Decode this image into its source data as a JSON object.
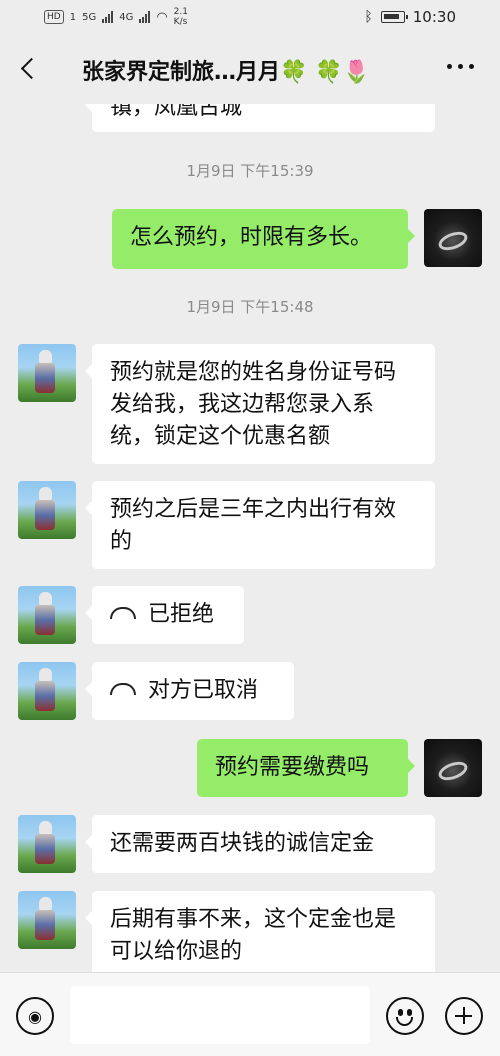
{
  "status_bar": {
    "hd": "HD",
    "sim": "1",
    "net1": "5G",
    "net2": "4G",
    "speed": "2.1 K/s",
    "time": "10:30"
  },
  "header": {
    "title": "张家界定制旅…月月🍀 🍀🌷",
    "back_icon": "chevron-left-icon",
    "more_icon": "more-dots-icon"
  },
  "chat": {
    "partial_message": "镇，凤凰古城",
    "timestamps": [
      "1月9日 下午15:39",
      "1月9日 下午15:48"
    ],
    "messages": [
      {
        "side": "self",
        "text": "怎么预约，时限有多长。"
      },
      {
        "side": "other",
        "text": "预约就是您的姓名身份证号码发给我，我这边帮您录入系统，锁定这个优惠名额"
      },
      {
        "side": "other",
        "text": "预约之后是三年之内出行有效的"
      },
      {
        "side": "other",
        "text": "已拒绝",
        "call": true
      },
      {
        "side": "other",
        "text": "对方已取消",
        "call": true
      },
      {
        "side": "self",
        "text": "预约需要缴费吗"
      },
      {
        "side": "other",
        "text": "还需要两百块钱的诚信定金"
      },
      {
        "side": "other",
        "text": "后期有事不来，这个定金也是可以给你退的"
      }
    ]
  },
  "input_bar": {
    "voice_icon": "voice-icon",
    "emoji_icon": "emoji-icon",
    "plus_icon": "plus-icon",
    "placeholder": ""
  },
  "colors": {
    "background": "#ededed",
    "self_bubble": "#95ec69",
    "other_bubble": "#ffffff",
    "timestamp": "#8a8a8a"
  }
}
